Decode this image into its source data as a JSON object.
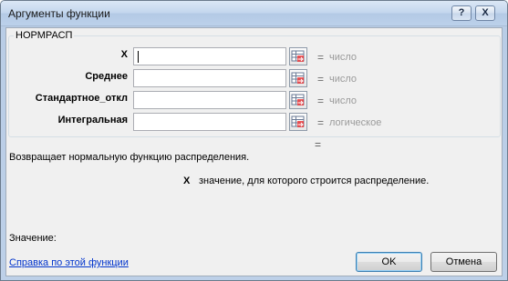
{
  "window": {
    "title": "Аргументы функции",
    "help_button": "?",
    "close_button": "X"
  },
  "function": {
    "name": "НОРМРАСП",
    "arguments": [
      {
        "label": "X",
        "value": "",
        "hint": "число",
        "equals": "="
      },
      {
        "label": "Среднее",
        "value": "",
        "hint": "число",
        "equals": "="
      },
      {
        "label": "Стандартное_откл",
        "value": "",
        "hint": "число",
        "equals": "="
      },
      {
        "label": "Интегральная",
        "value": "",
        "hint": "логическое",
        "equals": "="
      }
    ],
    "result_equals": "=",
    "description": "Возвращает нормальную функцию распределения.",
    "arg_description_name": "X",
    "arg_description_text": "значение, для которого строится распределение."
  },
  "footer": {
    "value_label": "Значение:",
    "help_link": "Справка по этой функции",
    "ok_label": "OK",
    "cancel_label": "Отмена"
  }
}
